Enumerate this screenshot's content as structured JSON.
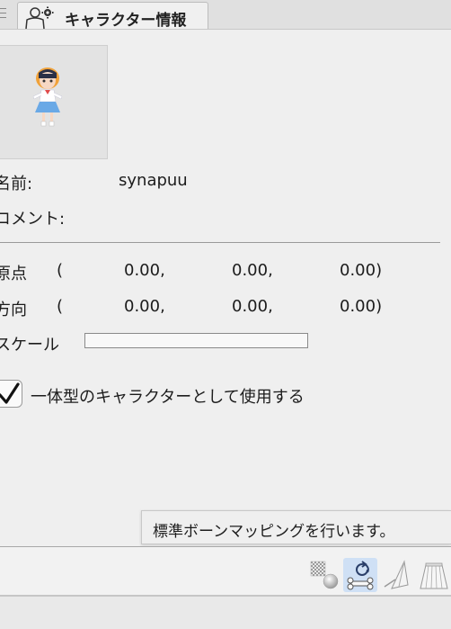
{
  "tab": {
    "title": "キャラクター情報"
  },
  "fields": {
    "name_label": "名前:",
    "name_value": "synapuu",
    "comment_label": "コメント:",
    "origin_label": "原点",
    "direction_label": "方向",
    "scale_label": "スケール",
    "paren_open": "(",
    "origin_x": "0.00,",
    "origin_y": "0.00,",
    "origin_z": "0.00)",
    "dir_x": "0.00,",
    "dir_y": "0.00,",
    "dir_z": "0.00)"
  },
  "checkbox": {
    "label": "一体型のキャラクターとして使用する",
    "checked": true
  },
  "tooltip": {
    "text": "標準ボーンマッピングを行います。"
  },
  "toolbar": {
    "icons": [
      "texture-sphere-icon",
      "bone-mapping-refresh-icon",
      "pose-icon",
      "skirt-icon"
    ],
    "active": "bone-mapping-refresh-icon"
  },
  "colors": {
    "accent": "#1d5fb5",
    "active_bg": "#cfe0f5"
  }
}
